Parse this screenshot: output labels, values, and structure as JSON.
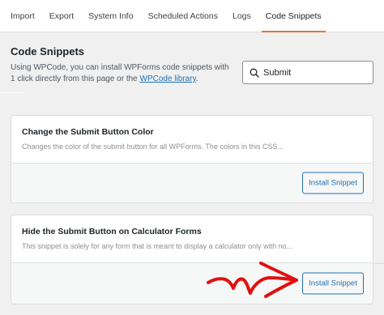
{
  "tabs": [
    {
      "label": "Import"
    },
    {
      "label": "Export"
    },
    {
      "label": "System Info"
    },
    {
      "label": "Scheduled Actions"
    },
    {
      "label": "Logs"
    },
    {
      "label": "Code Snippets"
    }
  ],
  "active_tab": "Code Snippets",
  "header": {
    "title": "Code Snippets",
    "description_before_link": "Using WPCode, you can install WPForms code snippets with 1 click directly from this page or the ",
    "library_link": "WPCode library",
    "description_after_link": "."
  },
  "search": {
    "value": "Submit",
    "icon": "search-icon"
  },
  "snippets": [
    {
      "title": "Change the Submit Button Color",
      "description": "Changes the color of the submit button for all WPForms. The colors in this CSS...",
      "button_label": "Install Snippet"
    },
    {
      "title": "Hide the Submit Button on Calculator Forms",
      "description": "This snippet is solely for any form that is meant to display a calculator only with no...",
      "button_label": "Install Snippet"
    }
  ],
  "colors": {
    "accent_tab": "#e27730",
    "link": "#2271b1",
    "annotation_arrow": "#e01010"
  }
}
